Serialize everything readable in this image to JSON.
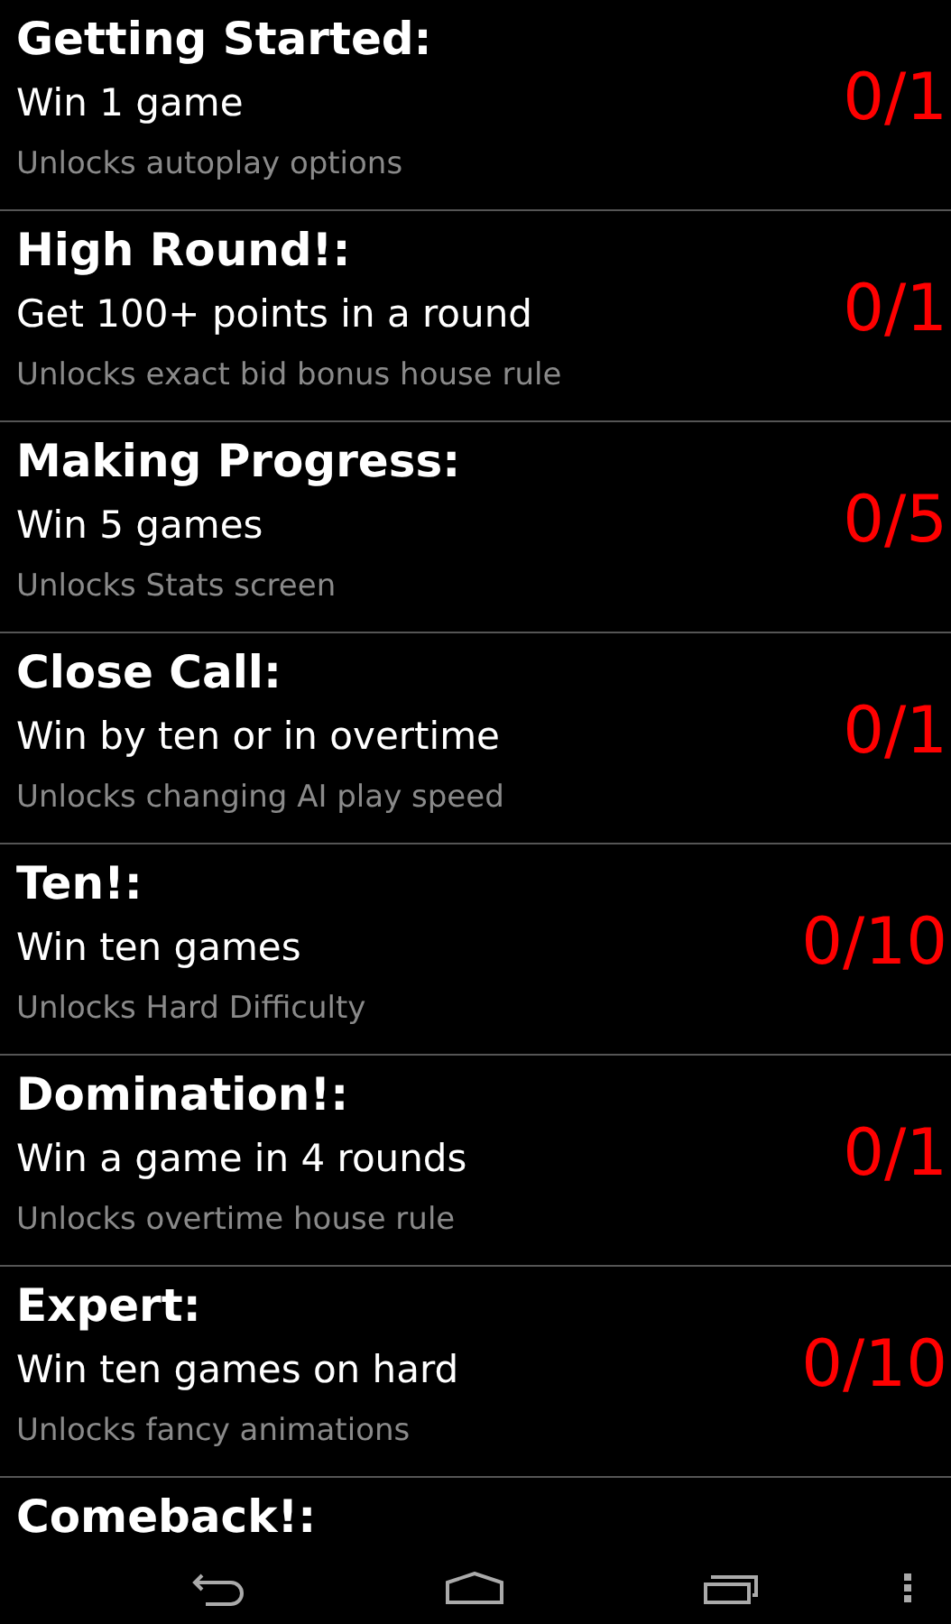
{
  "achievements": [
    {
      "title": "Getting Started:",
      "goal": "Win 1 game",
      "reward": "Unlocks autoplay options",
      "progress": "0/1"
    },
    {
      "title": "High Round!:",
      "goal": "Get 100+ points in a round",
      "reward": "Unlocks exact bid bonus house rule",
      "progress": "0/1"
    },
    {
      "title": "Making Progress:",
      "goal": "Win 5 games",
      "reward": "Unlocks Stats screen",
      "progress": "0/5"
    },
    {
      "title": "Close Call:",
      "goal": "Win by ten or in overtime",
      "reward": "Unlocks changing AI play speed",
      "progress": "0/1"
    },
    {
      "title": "Ten!:",
      "goal": "Win ten games",
      "reward": "Unlocks Hard Difficulty",
      "progress": "0/10"
    },
    {
      "title": "Domination!:",
      "goal": "Win a game in 4 rounds",
      "reward": "Unlocks overtime house rule",
      "progress": "0/1"
    },
    {
      "title": "Expert:",
      "goal": "Win ten games on hard",
      "reward": "Unlocks fancy animations",
      "progress": "0/10"
    },
    {
      "title": "Comeback!:"
    }
  ]
}
